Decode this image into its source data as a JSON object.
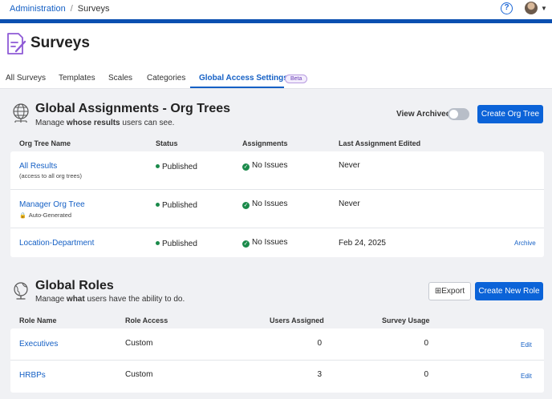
{
  "breadcrumb": {
    "parent": "Administration",
    "current": "Surveys"
  },
  "header": {
    "title": "Surveys"
  },
  "tabs": [
    {
      "label": "All Surveys"
    },
    {
      "label": "Templates"
    },
    {
      "label": "Scales"
    },
    {
      "label": "Categories"
    },
    {
      "label": "Global Access Settings",
      "active": true,
      "badge": "Beta"
    }
  ],
  "assignments": {
    "title": "Global Assignments - Org Trees",
    "subtitle_pre": "Manage ",
    "subtitle_bold": "whose results",
    "subtitle_post": " users can see.",
    "view_archived_label": "View Archived",
    "view_archived_on": false,
    "create_button": "Create Org Tree",
    "columns": [
      "Org Tree Name",
      "Status",
      "Assignments",
      "Last Assignment Edited"
    ],
    "rows": [
      {
        "name": "All Results",
        "note": "(access to all org trees)",
        "status": "Published",
        "assignments": "No Issues",
        "last_edited": "Never",
        "action": ""
      },
      {
        "name": "Manager Org Tree",
        "note": "Auto-Generated",
        "status": "Published",
        "assignments": "No Issues",
        "last_edited": "Never",
        "action": ""
      },
      {
        "name": "Location-Department",
        "note": "",
        "status": "Published",
        "assignments": "No Issues",
        "last_edited": "Feb 24, 2025",
        "action": "Archive"
      }
    ]
  },
  "roles": {
    "title": "Global Roles",
    "subtitle_pre": "Manage ",
    "subtitle_bold": "what",
    "subtitle_post": " users have the ability to do.",
    "export_button": "Export",
    "create_button": "Create New Role",
    "columns": [
      "Role Name",
      "Role Access",
      "Users Assigned",
      "Survey Usage"
    ],
    "rows": [
      {
        "name": "Executives",
        "access": "Custom",
        "users": "0",
        "usage": "0",
        "action": "Edit"
      },
      {
        "name": "HRBPs",
        "access": "Custom",
        "users": "3",
        "usage": "0",
        "action": "Edit"
      }
    ]
  },
  "colors": {
    "primary": "#0b63d8",
    "topbar_accent": "#0b4fb0",
    "published": "#1a8a4a",
    "link": "#1560c5"
  }
}
